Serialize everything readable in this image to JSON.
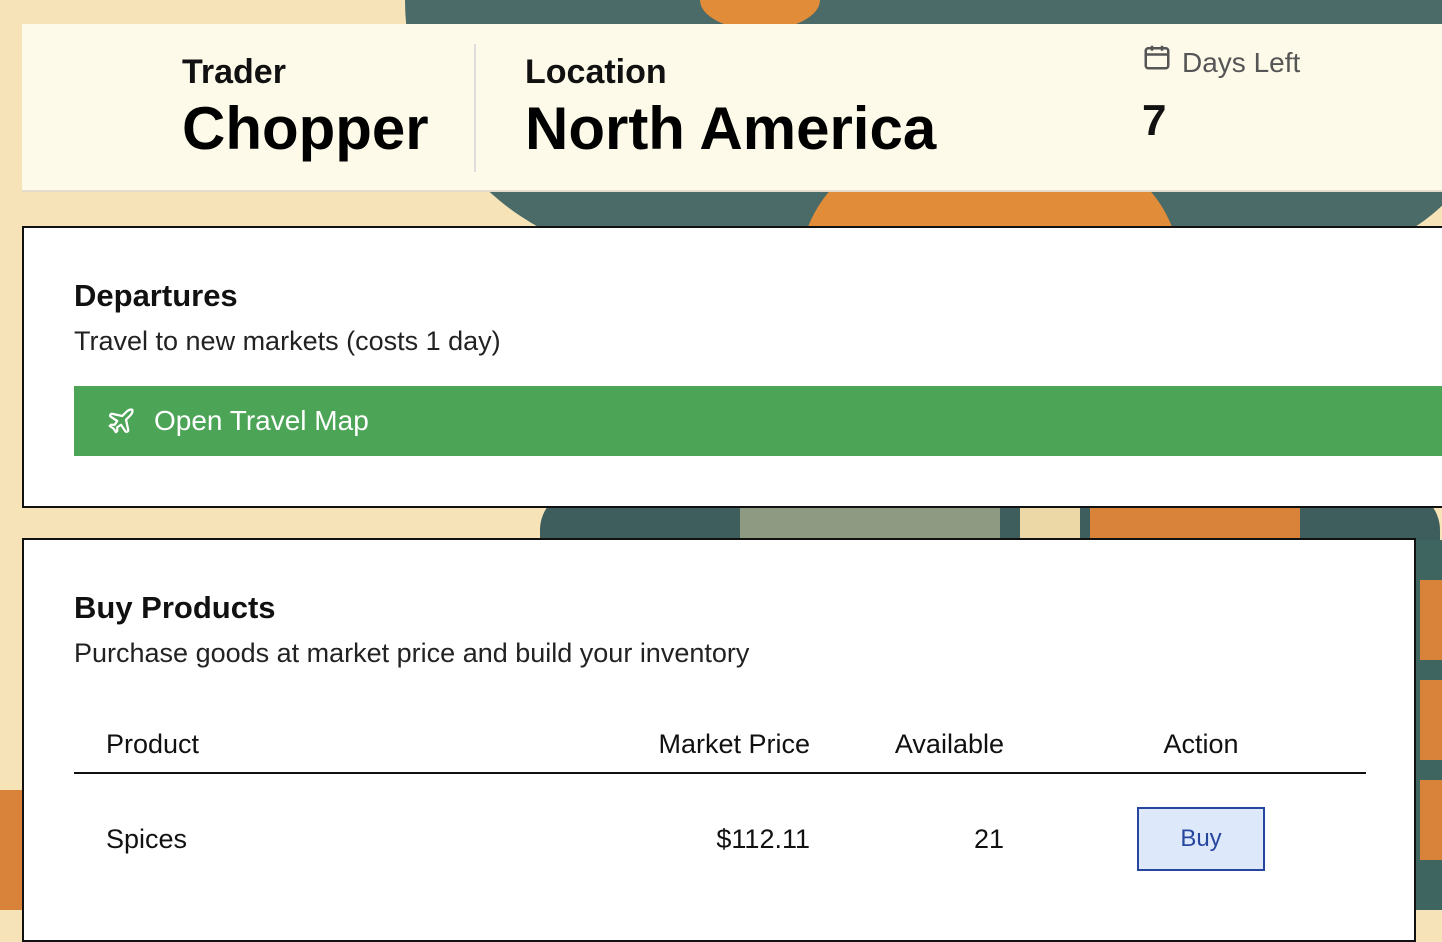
{
  "header": {
    "trader_label": "Trader",
    "trader_name": "Chopper",
    "location_label": "Location",
    "location_name": "North America",
    "days_label": "Days Left",
    "days_value": "7",
    "days_icon": "calendar-icon"
  },
  "departures": {
    "title": "Departures",
    "subtitle": "Travel to new markets (costs 1 day)",
    "button_label": "Open Travel Map",
    "button_icon": "airplane-icon",
    "button_color": "#4ca456"
  },
  "buy": {
    "title": "Buy Products",
    "subtitle": "Purchase goods at market price and build your inventory",
    "columns": [
      "Product",
      "Market Price",
      "Available",
      "Action"
    ],
    "rows": [
      {
        "product": "Spices",
        "price": "$112.11",
        "available": "21",
        "action": "Buy"
      }
    ]
  }
}
